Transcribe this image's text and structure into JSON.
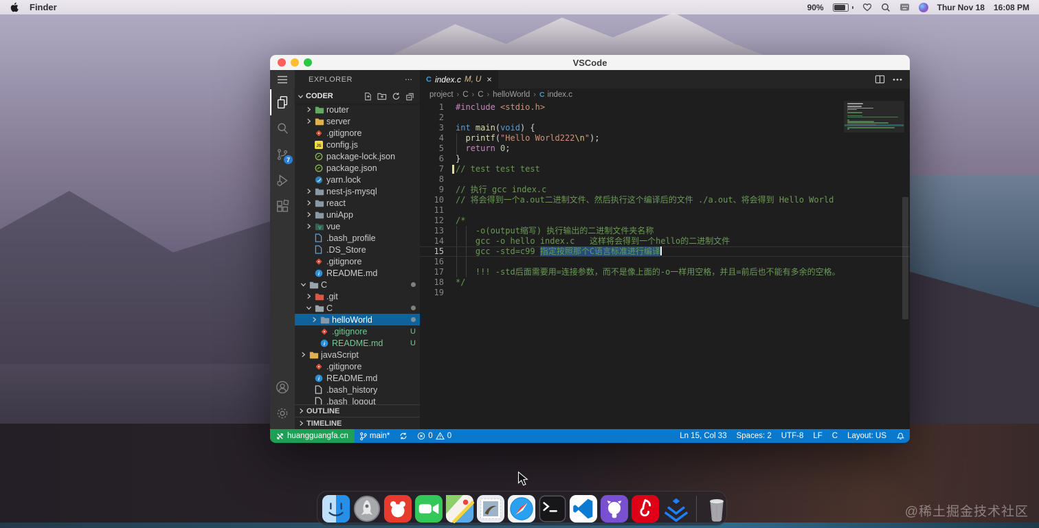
{
  "menu_bar": {
    "app_name": "Finder",
    "battery_pct": "90%",
    "date": "Thur Nov 18",
    "time": "16:08 PM",
    "icons": [
      "apple-icon",
      "battery-icon",
      "heart-icon",
      "search-icon",
      "input-source-icon",
      "siri-icon"
    ]
  },
  "window": {
    "title": "VSCode"
  },
  "activity_bar": {
    "top": [
      "explorer",
      "search",
      "source-control",
      "run-debug",
      "extensions"
    ],
    "bottom": [
      "account",
      "settings"
    ],
    "active": "explorer",
    "scm_badge": "7"
  },
  "sidebar": {
    "header": "EXPLORER",
    "more": "⋯",
    "section": "CODER",
    "actions": [
      "new-file",
      "new-folder",
      "refresh",
      "collapse-all"
    ],
    "outline_label": "OUTLINE",
    "timeline_label": "TIMELINE",
    "tree": [
      {
        "name": "router",
        "icon": "folder-green",
        "chev": ">",
        "indent": 1
      },
      {
        "name": "server",
        "icon": "folder-yellow",
        "chev": ">",
        "indent": 1
      },
      {
        "name": ".gitignore",
        "icon": "git",
        "indent": 1
      },
      {
        "name": "config.js",
        "icon": "js",
        "indent": 1
      },
      {
        "name": "package-lock.json",
        "icon": "npm",
        "indent": 1
      },
      {
        "name": "package.json",
        "icon": "npm",
        "indent": 1
      },
      {
        "name": "yarn.lock",
        "icon": "yarn",
        "indent": 1
      },
      {
        "name": "nest-js-mysql",
        "icon": "folder-gray",
        "chev": ">",
        "indent": 1
      },
      {
        "name": "react",
        "icon": "folder-gray",
        "chev": ">",
        "indent": 1
      },
      {
        "name": "uniApp",
        "icon": "folder-gray",
        "chev": ">",
        "indent": 1
      },
      {
        "name": "vue",
        "icon": "folder-vue",
        "chev": ">",
        "indent": 1
      },
      {
        "name": ".bash_profile",
        "icon": "file-blue",
        "indent": 1
      },
      {
        "name": ".DS_Store",
        "icon": "file-blue",
        "indent": 1
      },
      {
        "name": ".gitignore",
        "icon": "git",
        "indent": 1
      },
      {
        "name": "README.md",
        "icon": "readme",
        "indent": 1
      },
      {
        "name": "C",
        "icon": "folder-open",
        "chev": "v",
        "indent": 0,
        "dot": true
      },
      {
        "name": ".git",
        "icon": "folder-git",
        "chev": ">",
        "indent": 1
      },
      {
        "name": "C",
        "icon": "folder-open",
        "chev": "v",
        "indent": 1,
        "dot": true
      },
      {
        "name": "helloWorld",
        "icon": "folder-gray",
        "chev": ">",
        "indent": 2,
        "selected": true,
        "dot": true
      },
      {
        "name": ".gitignore",
        "icon": "git",
        "indent": 2,
        "badge": "U",
        "green": true
      },
      {
        "name": "README.md",
        "icon": "readme",
        "indent": 2,
        "badge": "U",
        "green": true
      },
      {
        "name": "javaScript",
        "icon": "folder-yellow",
        "chev": ">",
        "indent": 0
      },
      {
        "name": ".gitignore",
        "icon": "git",
        "indent": 1
      },
      {
        "name": "README.md",
        "icon": "readme",
        "indent": 1
      },
      {
        "name": ".bash_history",
        "icon": "file-plain",
        "indent": 1
      },
      {
        "name": ".bash_logout",
        "icon": "file-plain",
        "indent": 1
      }
    ]
  },
  "tab": {
    "icon": "C",
    "title": "index.c",
    "flags": "M, U",
    "close": "×"
  },
  "breadcrumbs": {
    "items": [
      "project",
      "C",
      "C",
      "helloWorld"
    ],
    "file": "index.c"
  },
  "editor": {
    "active_line": 15,
    "git_marker_line": 7,
    "lines": [
      {
        "n": 1,
        "toks": [
          {
            "c": "pp",
            "s": "#include"
          },
          {
            "c": "pln",
            "s": " "
          },
          {
            "c": "str",
            "s": "<stdio.h>"
          }
        ]
      },
      {
        "n": 2,
        "toks": []
      },
      {
        "n": 3,
        "toks": [
          {
            "c": "type",
            "s": "int"
          },
          {
            "c": "pln",
            "s": " "
          },
          {
            "c": "fn",
            "s": "main"
          },
          {
            "c": "pln",
            "s": "("
          },
          {
            "c": "type",
            "s": "void"
          },
          {
            "c": "pln",
            "s": ") {"
          }
        ]
      },
      {
        "n": 4,
        "toks": [
          {
            "c": "pln",
            "s": "  "
          },
          {
            "c": "fn",
            "s": "printf"
          },
          {
            "c": "pln",
            "s": "("
          },
          {
            "c": "str",
            "s": "\"Hello World222"
          },
          {
            "c": "esc",
            "s": "\\n"
          },
          {
            "c": "str",
            "s": "\""
          },
          {
            "c": "pln",
            "s": ");"
          }
        ]
      },
      {
        "n": 5,
        "toks": [
          {
            "c": "pln",
            "s": "  "
          },
          {
            "c": "pp",
            "s": "return"
          },
          {
            "c": "pln",
            "s": " "
          },
          {
            "c": "num",
            "s": "0"
          },
          {
            "c": "pln",
            "s": ";"
          }
        ]
      },
      {
        "n": 6,
        "toks": [
          {
            "c": "pln",
            "s": "}"
          }
        ]
      },
      {
        "n": 7,
        "toks": [
          {
            "c": "cmt",
            "s": "// test test test"
          }
        ]
      },
      {
        "n": 8,
        "toks": []
      },
      {
        "n": 9,
        "toks": [
          {
            "c": "cmt",
            "s": "// 执行 gcc index.c"
          }
        ]
      },
      {
        "n": 10,
        "toks": [
          {
            "c": "cmt",
            "s": "// 将会得到一个a.out二进制文件、然后执行这个编译后的文件 ./a.out、将会得到 Hello World"
          }
        ]
      },
      {
        "n": 11,
        "toks": []
      },
      {
        "n": 12,
        "toks": [
          {
            "c": "cmt",
            "s": "/*"
          }
        ]
      },
      {
        "n": 13,
        "toks": [
          {
            "c": "cmt",
            "s": "    -o(output缩写) 执行输出的二进制文件夹名称"
          }
        ]
      },
      {
        "n": 14,
        "toks": [
          {
            "c": "cmt",
            "s": "    gcc -o hello index.c   这样将会得到一个hello的二进制文件"
          }
        ]
      },
      {
        "n": 15,
        "toks": [
          {
            "c": "cmt",
            "s": "    gcc -std=c99 "
          },
          {
            "c": "cmt",
            "s": "指定按照那个C语言标准进行编译",
            "sel": true
          }
        ]
      },
      {
        "n": 16,
        "toks": []
      },
      {
        "n": 17,
        "toks": [
          {
            "c": "cmt",
            "s": "    !!! -std后面需要用=连接参数，而不是像上面的-o一样用空格，并且=前后也不能有多余的空格。"
          }
        ]
      },
      {
        "n": 18,
        "toks": [
          {
            "c": "cmt",
            "s": "*/"
          }
        ]
      },
      {
        "n": 19,
        "toks": []
      }
    ]
  },
  "status_bar": {
    "remote": "huangguangfa.cn",
    "branch": "main*",
    "errors": "0",
    "warnings": "0",
    "right": [
      "Ln 15, Col 33",
      "Spaces: 2",
      "UTF-8",
      "LF",
      "C",
      "Layout: US"
    ]
  },
  "dock": {
    "apps": [
      "finder",
      "launchpad",
      "bear",
      "facetime",
      "maps",
      "mail",
      "safari",
      "terminal",
      "vscode",
      "github",
      "netease-music",
      "juejin"
    ],
    "trash": "trash"
  },
  "watermark": "@稀土掘金技术社区",
  "colors": {
    "status_bar": "#0a79cc",
    "remote": "#1f9e55",
    "list_selection": "#0e639c",
    "text_selection": "#264F78",
    "untracked": "#73C991",
    "modified_flag": "#e2c08d",
    "activity_badge": "#2a7fd4",
    "comment": "#6A9955"
  }
}
